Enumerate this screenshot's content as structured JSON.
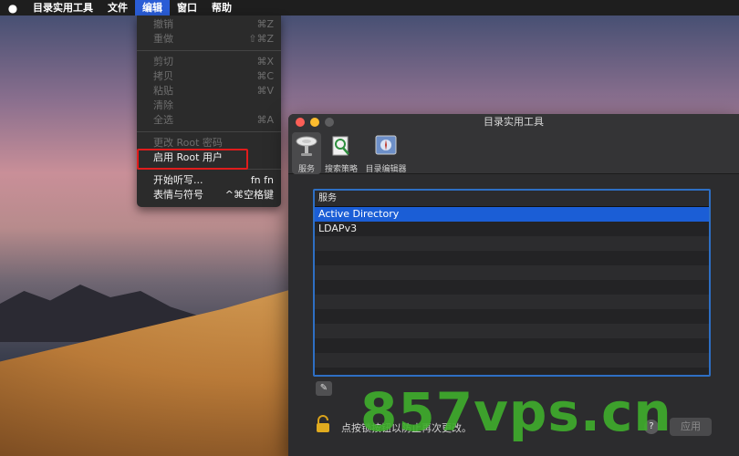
{
  "menubar": {
    "apple_icon": "apple-icon",
    "items": [
      {
        "label": "目录实用工具"
      },
      {
        "label": "文件"
      },
      {
        "label": "编辑"
      },
      {
        "label": "窗口"
      },
      {
        "label": "帮助"
      }
    ]
  },
  "dropdown": {
    "undo": {
      "label": "撤销",
      "shortcut": "⌘Z"
    },
    "redo": {
      "label": "重做",
      "shortcut": "⇧⌘Z"
    },
    "cut": {
      "label": "剪切",
      "shortcut": "⌘X"
    },
    "copy": {
      "label": "拷贝",
      "shortcut": "⌘C"
    },
    "paste": {
      "label": "粘贴",
      "shortcut": "⌘V"
    },
    "clear": {
      "label": "清除",
      "shortcut": ""
    },
    "select_all": {
      "label": "全选",
      "shortcut": "⌘A"
    },
    "change_root": {
      "label": "更改 Root 密码",
      "shortcut": ""
    },
    "enable_root": {
      "label": "启用 Root 用户",
      "shortcut": ""
    },
    "dictation": {
      "label": "开始听写...",
      "shortcut": "fn fn"
    },
    "emoji": {
      "label": "表情与符号",
      "shortcut": "^⌘空格键"
    }
  },
  "window": {
    "title": "目录实用工具",
    "toolbar": [
      {
        "label": "服务",
        "icon": "services-icon"
      },
      {
        "label": "搜索策略",
        "icon": "search-policy-icon"
      },
      {
        "label": "目录编辑器",
        "icon": "directory-editor-icon"
      }
    ],
    "panel": {
      "header": "服务",
      "rows": [
        "Active Directory",
        "LDAPv3"
      ]
    },
    "edit_button": "✎",
    "lock_text": "点按锁按钮以防止再次更改。",
    "help": "?",
    "apply": "应用"
  },
  "watermark": "857vps.cn",
  "colors": {
    "accent": "#1b5ed6",
    "highlight_border": "#e01c1c",
    "watermark": "#3fae2c"
  }
}
